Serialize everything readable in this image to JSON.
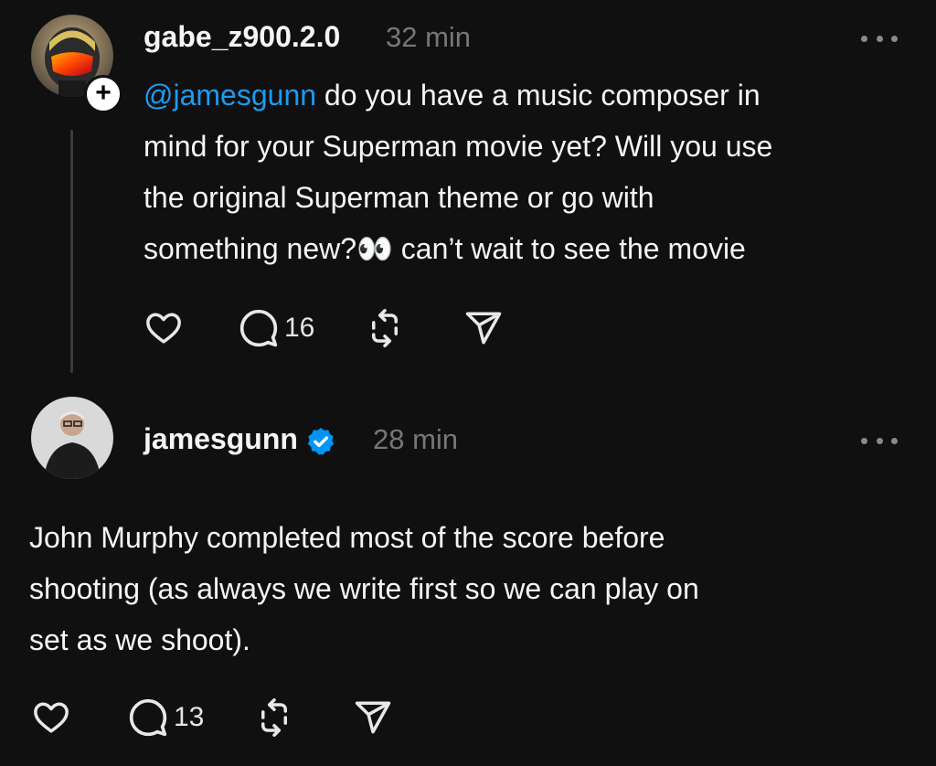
{
  "posts": [
    {
      "username": "gabe_z900.2.0",
      "time": "32 min",
      "mention": "@jamesgunn",
      "text_lines": [
        " do you have a music composer in",
        "mind for your Superman movie yet? Will you use",
        "the original Superman theme or go with",
        "something new?👀 can’t wait to see the movie"
      ],
      "reply_count": "16",
      "follow_badge": "+",
      "verified": false
    },
    {
      "username": "jamesgunn",
      "time": "28 min",
      "text_lines": [
        "John Murphy completed most of the score before",
        "shooting (as always we write first so we can play on",
        "set as we shoot)."
      ],
      "reply_count": "13",
      "verified": true
    }
  ],
  "colors": {
    "background": "#101010",
    "text": "#f3f5f7",
    "muted": "#777777",
    "mention": "#1d9bf0",
    "verified": "#0095f6"
  },
  "icons": [
    "heart-icon",
    "comment-icon",
    "repost-icon",
    "share-icon",
    "more-icon",
    "verified-icon",
    "follow-plus-icon"
  ]
}
